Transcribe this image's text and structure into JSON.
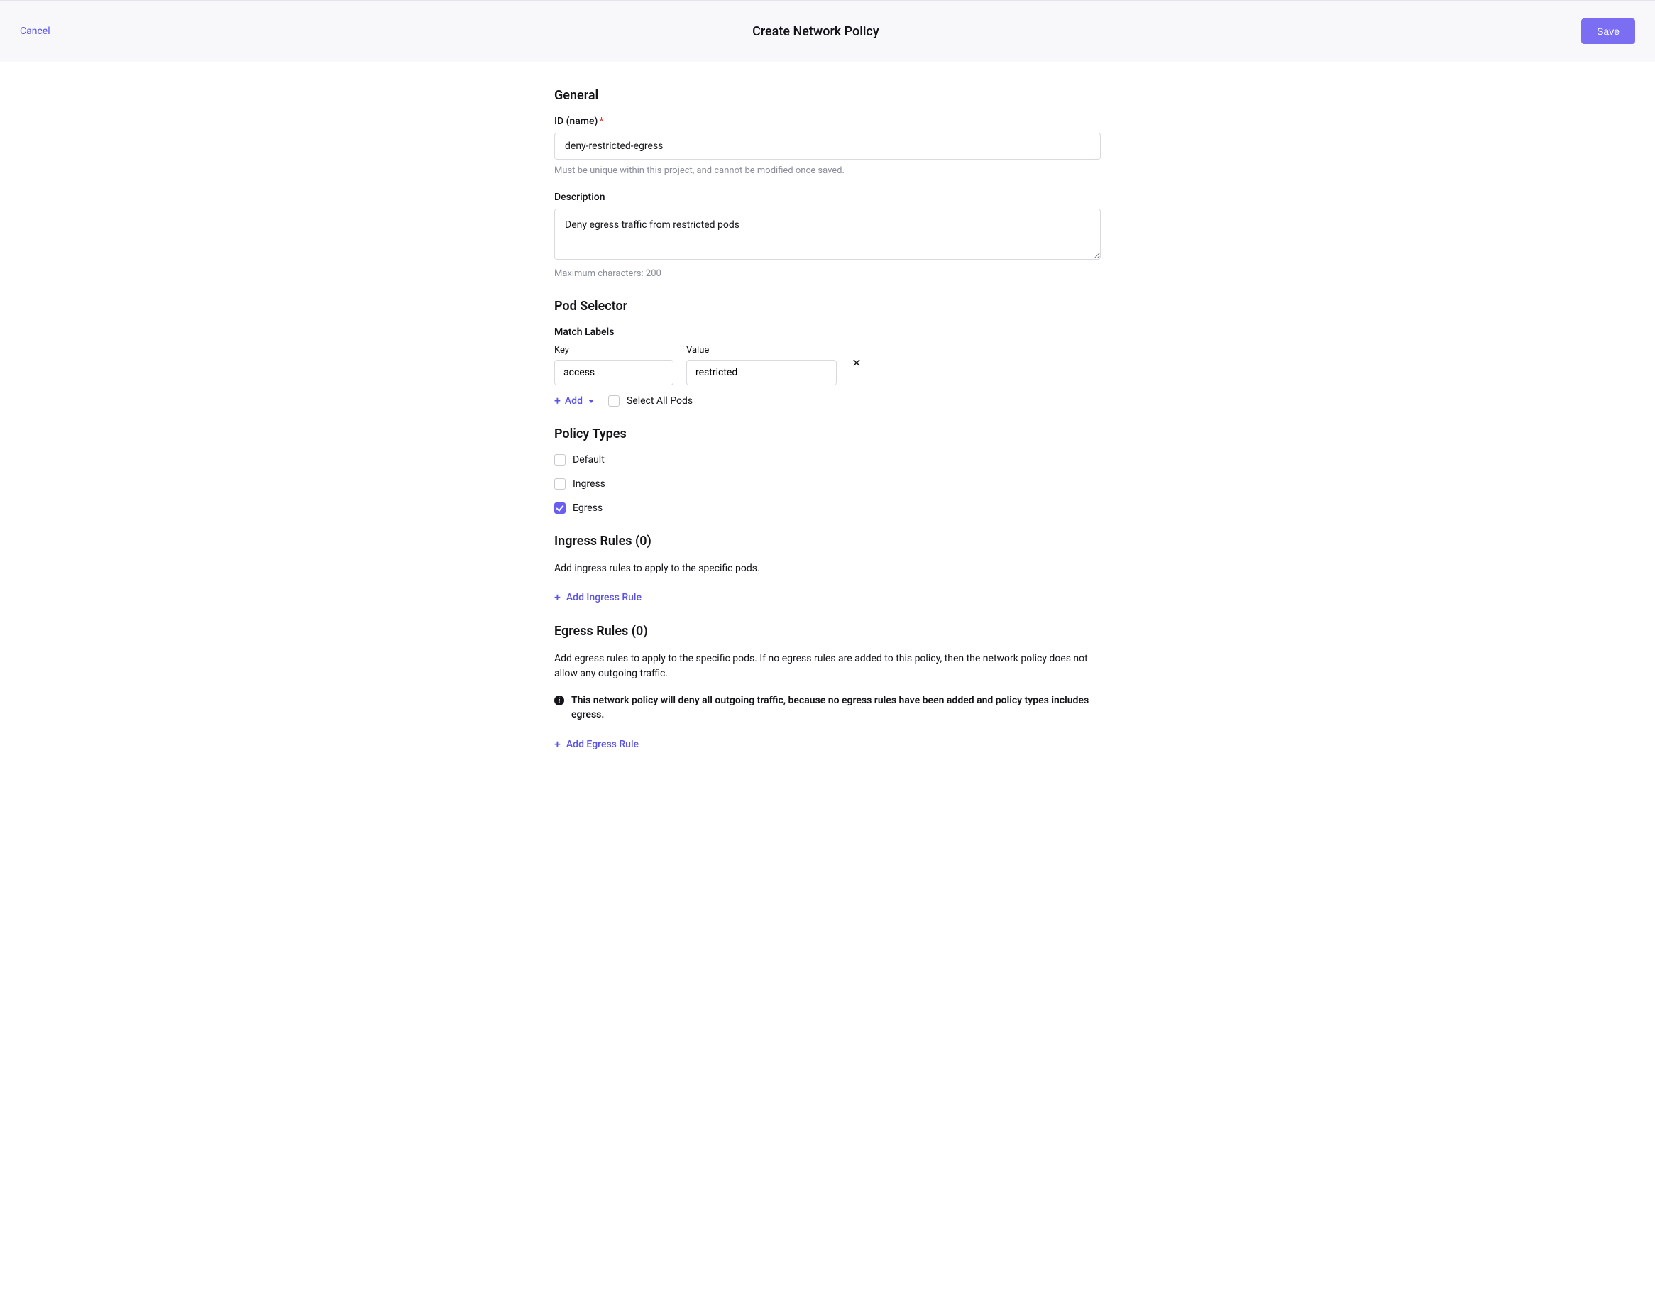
{
  "header": {
    "cancel": "Cancel",
    "title": "Create Network Policy",
    "save": "Save"
  },
  "general": {
    "heading": "General",
    "id_label": "ID (name)",
    "id_value": "deny-restricted-egress",
    "id_help": "Must be unique within this project, and cannot be modified once saved.",
    "desc_label": "Description",
    "desc_value": "Deny egress traffic from restricted pods",
    "desc_help": "Maximum characters: 200"
  },
  "pod_selector": {
    "heading": "Pod Selector",
    "match_labels": "Match Labels",
    "key_label": "Key",
    "value_label": "Value",
    "row": {
      "key": "access",
      "value": "restricted"
    },
    "add": "Add",
    "select_all": "Select All Pods"
  },
  "policy_types": {
    "heading": "Policy Types",
    "default": "Default",
    "ingress": "Ingress",
    "egress": "Egress"
  },
  "ingress": {
    "heading": "Ingress Rules (0)",
    "desc": "Add ingress rules to apply to the specific pods.",
    "add": "Add Ingress Rule"
  },
  "egress": {
    "heading": "Egress Rules (0)",
    "desc": "Add egress rules to apply to the specific pods. If no egress rules are added to this policy, then the network policy does not allow any outgoing traffic.",
    "info": "This network policy will deny all outgoing traffic, because no egress rules have been added and policy types includes egress.",
    "add": "Add Egress Rule"
  }
}
